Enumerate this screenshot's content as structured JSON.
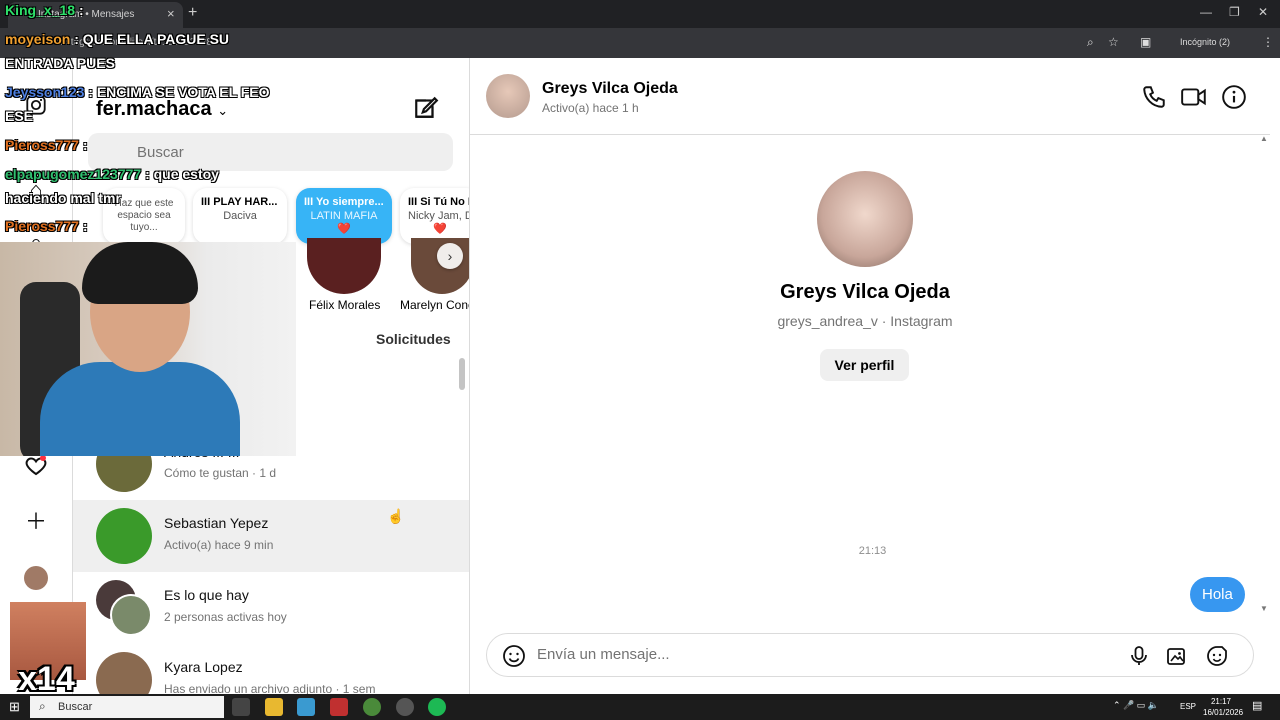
{
  "browser": {
    "tab_title": "Instagram • Mensajes",
    "url": "instagram.com/direct/t/...34023628/",
    "incognito_label": "Incógnito (2)"
  },
  "sidebar": {
    "username": "fer.machaca",
    "search_placeholder": "Buscar",
    "notes": [
      {
        "title": "",
        "sub": "Haz que este espacio sea tuyo..."
      },
      {
        "title": "III PLAY HAR...",
        "sub": "Daciva"
      },
      {
        "title": "III Yo siempre...",
        "sub": "LATIN MAFIA"
      },
      {
        "title": "III Si Tú No E",
        "sub": "Nicky Jam, D"
      }
    ],
    "stories": [
      {
        "name": "Félix Morales"
      },
      {
        "name": "Marelyn Conc"
      }
    ],
    "requests_label": "Solicitudes",
    "conversations": [
      {
        "name": "Andres ... ...",
        "sub": "Cómo te gustan · 1 d"
      },
      {
        "name": "Sebastian Yepez",
        "sub": "Activo(a) hace 9 min"
      },
      {
        "name": "Es lo que hay",
        "sub": "2 personas activas hoy"
      },
      {
        "name": "Kyara Lopez",
        "sub": "Has enviado un archivo adjunto · 1 sem"
      }
    ]
  },
  "chat": {
    "header_name": "Greys Vilca Ojeda",
    "header_status": "Activo(a) hace 1 h",
    "profile_name": "Greys Vilca Ojeda",
    "profile_sub": "greys_andrea_v · Instagram",
    "profile_button": "Ver perfil",
    "timestamp": "21:13",
    "messages": [
      {
        "text": "Hola",
        "from": "me"
      }
    ],
    "input_placeholder": "Envía un mensaje..."
  },
  "taskbar": {
    "search_label": "Buscar",
    "lang": "ESP",
    "time": "21:17",
    "date": "16/01/2026"
  },
  "stream_overlay": {
    "chat_lines": [
      {
        "user": "King_x_18",
        "msg": ":"
      },
      {
        "user": "moyeison",
        "msg": ": QUE ELLA PAGUE SU"
      },
      {
        "user": "",
        "msg": "ENTRADA PUES"
      },
      {
        "user": "Jeysson123",
        "msg": ": ENCIMA SE VOTA EL FEO"
      },
      {
        "user": "",
        "msg": "ESE"
      },
      {
        "user": "Pieross777",
        "msg": ":"
      },
      {
        "user": "elpapugomez123777",
        "msg": ": que estoy"
      },
      {
        "user": "",
        "msg": "haciendo mal tmr"
      },
      {
        "user": "Pieross777",
        "msg": ":"
      }
    ],
    "emote_count": "x14",
    "colors": {
      "King_x_18": "#2ee06a",
      "moyeison": "#f0a030",
      "Jeysson123": "#4d7fe0",
      "Pieross777": "#e07020",
      "elpapugomez123777": "#30c070"
    }
  },
  "icons": [
    "instagram-icon",
    "home-icon",
    "search-icon",
    "heart-icon",
    "plus-icon",
    "compose-icon",
    "phone-icon",
    "video-icon",
    "info-icon",
    "emoji-icon",
    "microphone-icon",
    "image-icon",
    "sticker-icon",
    "chevron-right-icon"
  ],
  "colors": {
    "accent": "#3797f0",
    "note_active": "#37b4f6"
  }
}
